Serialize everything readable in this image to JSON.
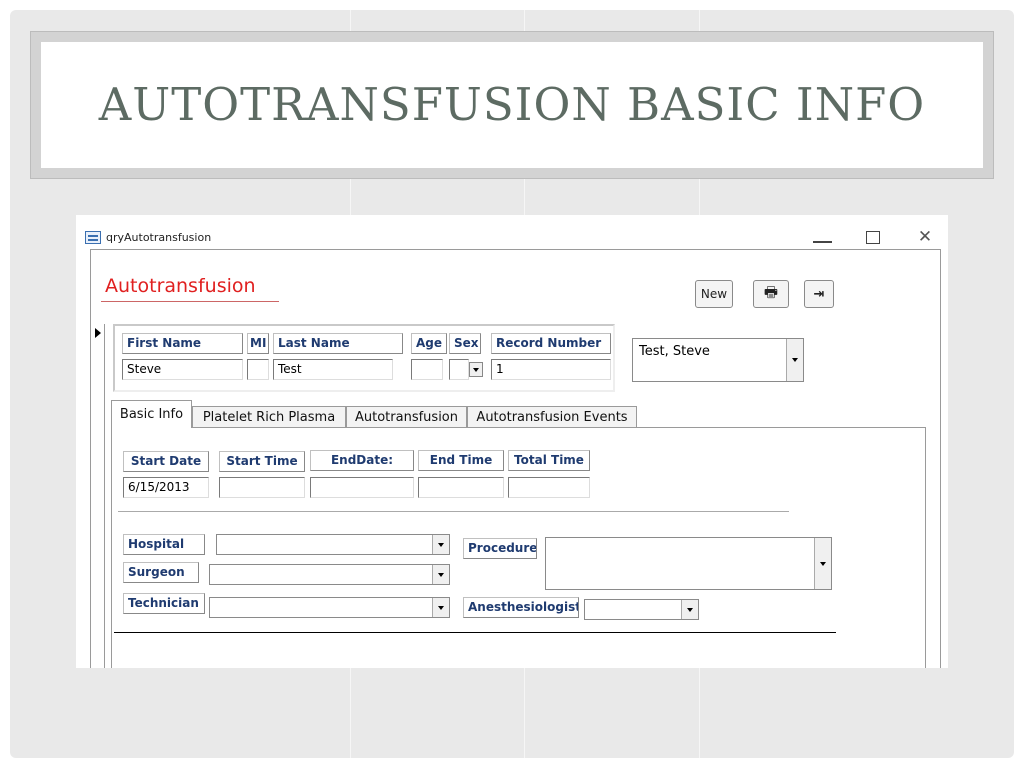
{
  "slide": {
    "title": "AUTOTRANSFUSION BASIC INFO"
  },
  "window": {
    "title": "qryAutotransfusion",
    "controls": {
      "close_glyph": "✕"
    }
  },
  "form": {
    "title": "Autotransfusion",
    "buttons": {
      "new_label": "New",
      "print_icon": "🖶",
      "exit_icon": "⇥"
    },
    "patient": {
      "labels": {
        "first_name": "First Name",
        "mi": "MI",
        "last_name": "Last Name",
        "age": "Age",
        "sex": "Sex",
        "record_number": "Record Number"
      },
      "values": {
        "first_name": "Steve",
        "mi": "",
        "last_name": "Test",
        "age": "",
        "sex": "",
        "record_number": "1"
      },
      "lookup_value": "Test, Steve"
    },
    "tabs": [
      "Basic Info",
      "Platelet Rich Plasma",
      "Autotransfusion",
      "Autotransfusion Events"
    ],
    "active_tab": "Basic Info",
    "basic_info": {
      "labels": {
        "start_date": "Start Date",
        "start_time": "Start Time",
        "end_date": "EndDate:",
        "end_time": "End Time",
        "total_time": "Total Time",
        "hospital": "Hospital",
        "surgeon": "Surgeon",
        "technician": "Technician",
        "procedure": "Procedure",
        "anesthesiologist": "Anesthesiologist"
      },
      "values": {
        "start_date": "6/15/2013",
        "start_time": "",
        "end_date": "",
        "end_time": "",
        "total_time": "",
        "hospital": "",
        "surgeon": "",
        "technician": "",
        "procedure": "",
        "anesthesiologist": ""
      }
    }
  },
  "colors": {
    "title_text": "#5d6b63",
    "form_title": "#e02020",
    "label_text": "#1f3b70"
  }
}
